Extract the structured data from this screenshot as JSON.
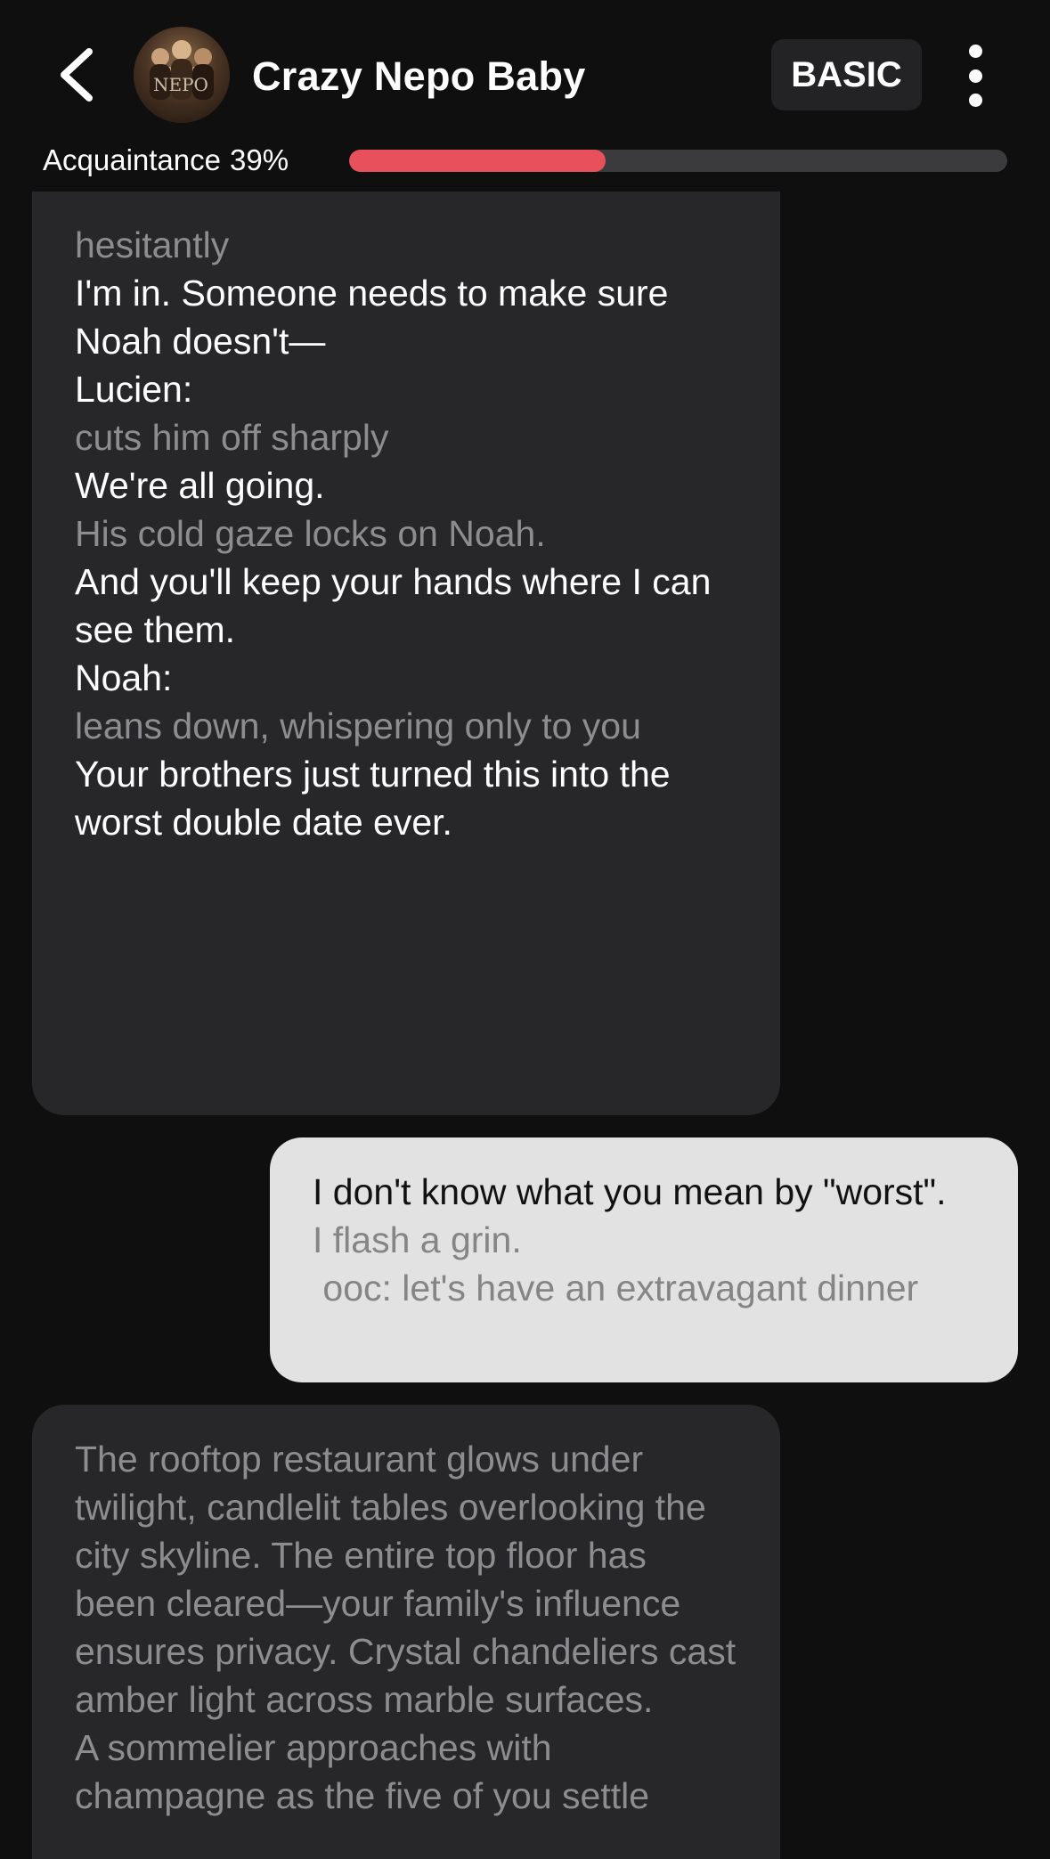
{
  "header": {
    "back_icon": "chevron-left-icon",
    "avatar_icon": "character-avatar",
    "title": "Crazy Nepo Baby",
    "plan_badge": "BASIC",
    "menu_icon": "more-vertical-icon"
  },
  "relationship": {
    "label": "Acquaintance",
    "percent_text": "39%",
    "progress": 0.39,
    "bar_color": "#e8505b"
  },
  "messages": [
    {
      "role": "ai",
      "lines": [
        {
          "kind": "action",
          "text": "hesitantly"
        },
        {
          "kind": "speech",
          "text": "I'm in. Someone needs to make sure Noah doesn't—"
        },
        {
          "kind": "speaker",
          "text": "Lucien:"
        },
        {
          "kind": "action",
          "text": "cuts him off sharply"
        },
        {
          "kind": "speech",
          "text": "We're all going."
        },
        {
          "kind": "action",
          "text": "His cold gaze locks on Noah."
        },
        {
          "kind": "speech",
          "text": "And you'll keep your hands where I can see them."
        },
        {
          "kind": "speaker",
          "text": "Noah:"
        },
        {
          "kind": "action",
          "text": "leans down, whispering only to you"
        },
        {
          "kind": "speech",
          "text": "Your brothers just turned this into the worst double date ever."
        }
      ]
    },
    {
      "role": "user",
      "lines": [
        {
          "kind": "speech",
          "text": "I don't know what you mean by \"worst\"."
        },
        {
          "kind": "action",
          "text": "I flash a grin."
        },
        {
          "kind": "action",
          "text": " ooc: let's have an extravagant dinner"
        }
      ]
    },
    {
      "role": "ai",
      "lines": [
        {
          "kind": "action",
          "text": "The rooftop restaurant glows under twilight, candlelit tables overlooking the city skyline. The entire top floor has been cleared—your family's influence ensures privacy. Crystal chandeliers cast amber light across marble surfaces."
        },
        {
          "kind": "action",
          "text": "A sommelier approaches with champagne as the five of you settle"
        }
      ]
    }
  ]
}
